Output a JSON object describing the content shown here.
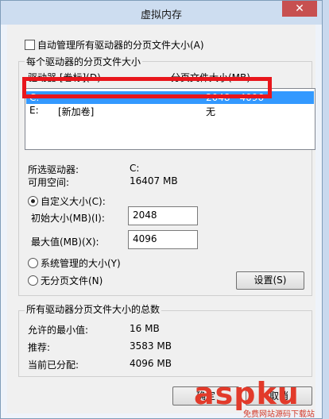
{
  "window": {
    "title": "虚拟内存",
    "close_glyph": "✕"
  },
  "auto_manage": {
    "label": "自动管理所有驱动器的分页文件大小(A)",
    "checked": false
  },
  "per_drive_group": {
    "title": "每个驱动器的分页文件大小",
    "columns": [
      "驱动器 [卷标](D)",
      "分页文件大小(MB)"
    ],
    "rows": [
      {
        "drive": "C:",
        "label": "",
        "size": "2048 - 4096",
        "selected": true
      },
      {
        "drive": "E:",
        "label": "[新加卷]",
        "size": "无",
        "selected": false
      }
    ]
  },
  "selected_info": {
    "drive_label": "所选驱动器:",
    "drive_value": "C:",
    "space_label": "可用空间:",
    "space_value": "16407 MB"
  },
  "custom_size": {
    "label": "自定义大小(C):",
    "selected": true,
    "initial_label": "初始大小(MB)(I):",
    "initial_value": "2048",
    "max_label": "最大值(MB)(X):",
    "max_value": "4096"
  },
  "system_managed": {
    "label": "系统管理的大小(Y)",
    "selected": false
  },
  "no_paging": {
    "label": "无分页文件(N)",
    "selected": false
  },
  "set_button": {
    "label": "设置(S)"
  },
  "totals_group": {
    "title": "所有驱动器分页文件大小的总数",
    "min_label": "允许的最小值:",
    "min_value": "16 MB",
    "rec_label": "推荐:",
    "rec_value": "3583 MB",
    "cur_label": "当前已分配:",
    "cur_value": "4096 MB"
  },
  "buttons": {
    "ok": "确定",
    "cancel": "取消"
  },
  "watermark": {
    "brand": "aspku",
    "sub": "免费网站源码下载站"
  },
  "colors": {
    "highlight": "#3399ff",
    "annotation_red": "#e8161c"
  }
}
